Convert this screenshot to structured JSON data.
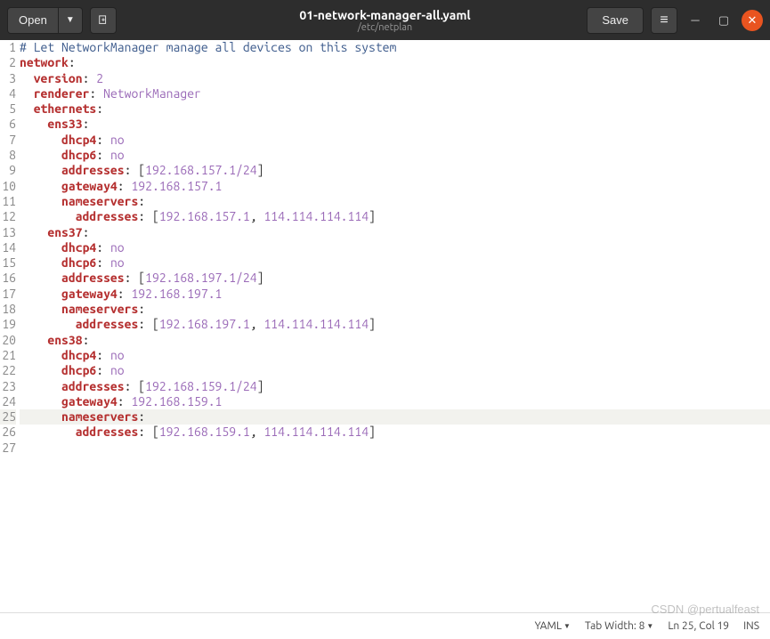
{
  "titlebar": {
    "open_label": "Open",
    "save_label": "Save",
    "filename": "01-network-manager-all.yaml",
    "path": "/etc/netplan"
  },
  "code": {
    "lines": [
      {
        "n": 1,
        "t": "comment",
        "text": "# Let NetworkManager manage all devices on this system"
      },
      {
        "n": 2,
        "t": "kv",
        "key": "network",
        "pad": ""
      },
      {
        "n": 3,
        "t": "kv",
        "key": "version",
        "val": "2",
        "pad": "  "
      },
      {
        "n": 4,
        "t": "kv",
        "key": "renderer",
        "val": "NetworkManager",
        "pad": "  "
      },
      {
        "n": 5,
        "t": "kv",
        "key": "ethernets",
        "pad": "  "
      },
      {
        "n": 6,
        "t": "kv",
        "key": "ens33",
        "pad": "    "
      },
      {
        "n": 7,
        "t": "kv",
        "key": "dhcp4",
        "val": "no",
        "pad": "      "
      },
      {
        "n": 8,
        "t": "kv",
        "key": "dhcp6",
        "val": "no",
        "pad": "      "
      },
      {
        "n": 9,
        "t": "arr",
        "key": "addresses",
        "vals": [
          "192.168.157.1/24"
        ],
        "pad": "      "
      },
      {
        "n": 10,
        "t": "kv",
        "key": "gateway4",
        "val": "192.168.157.1",
        "pad": "      "
      },
      {
        "n": 11,
        "t": "kv",
        "key": "nameservers",
        "pad": "      "
      },
      {
        "n": 12,
        "t": "arr",
        "key": "addresses",
        "vals": [
          "192.168.157.1",
          "114.114.114.114"
        ],
        "pad": "        "
      },
      {
        "n": 13,
        "t": "kv",
        "key": "ens37",
        "pad": "    "
      },
      {
        "n": 14,
        "t": "kv",
        "key": "dhcp4",
        "val": "no",
        "pad": "      "
      },
      {
        "n": 15,
        "t": "kv",
        "key": "dhcp6",
        "val": "no",
        "pad": "      "
      },
      {
        "n": 16,
        "t": "arr",
        "key": "addresses",
        "vals": [
          "192.168.197.1/24"
        ],
        "pad": "      "
      },
      {
        "n": 17,
        "t": "kv",
        "key": "gateway4",
        "val": "192.168.197.1",
        "pad": "      "
      },
      {
        "n": 18,
        "t": "kv",
        "key": "nameservers",
        "pad": "      "
      },
      {
        "n": 19,
        "t": "arr",
        "key": "addresses",
        "vals": [
          "192.168.197.1",
          "114.114.114.114"
        ],
        "pad": "        "
      },
      {
        "n": 20,
        "t": "kv",
        "key": "ens38",
        "pad": "    "
      },
      {
        "n": 21,
        "t": "kv",
        "key": "dhcp4",
        "val": "no",
        "pad": "      "
      },
      {
        "n": 22,
        "t": "kv",
        "key": "dhcp6",
        "val": "no",
        "pad": "      "
      },
      {
        "n": 23,
        "t": "arr",
        "key": "addresses",
        "vals": [
          "192.168.159.1/24"
        ],
        "pad": "      "
      },
      {
        "n": 24,
        "t": "kv",
        "key": "gateway4",
        "val": "192.168.159.1",
        "pad": "      "
      },
      {
        "n": 25,
        "t": "kv",
        "key": "nameservers",
        "pad": "      ",
        "current": true
      },
      {
        "n": 26,
        "t": "arr",
        "key": "addresses",
        "vals": [
          "192.168.159.1",
          "114.114.114.114"
        ],
        "pad": "        "
      },
      {
        "n": 27,
        "t": "empty"
      }
    ]
  },
  "statusbar": {
    "lang": "YAML",
    "tab": "Tab Width: 8",
    "pos": "Ln 25, Col 19",
    "mode": "INS"
  },
  "watermark": "CSDN @pertualfeast"
}
